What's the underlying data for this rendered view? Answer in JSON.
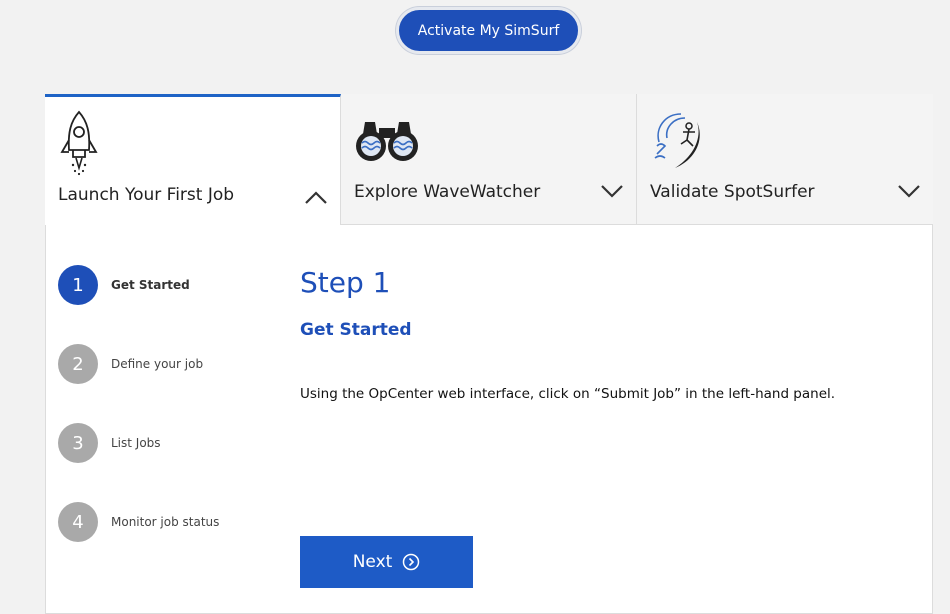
{
  "activate_button": {
    "label": "Activate My SimSurf"
  },
  "tabs": [
    {
      "label": "Launch Your First Job",
      "icon": "rocket-icon",
      "expanded": true
    },
    {
      "label": "Explore WaveWatcher",
      "icon": "binoculars-icon",
      "expanded": false
    },
    {
      "label": "Validate SpotSurfer",
      "icon": "surfer-icon",
      "expanded": false
    }
  ],
  "steps": [
    {
      "number": "1",
      "label": "Get Started",
      "active": true
    },
    {
      "number": "2",
      "label": "Define your job",
      "active": false
    },
    {
      "number": "3",
      "label": "List Jobs",
      "active": false
    },
    {
      "number": "4",
      "label": "Monitor job status",
      "active": false
    }
  ],
  "content": {
    "title": "Step 1",
    "subtitle": "Get Started",
    "body": "Using the OpCenter web interface, click on “Submit Job” in the left-hand panel."
  },
  "next_button": {
    "label": "Next",
    "icon": "arrow-circle-right-icon"
  },
  "colors": {
    "primary": "#1e4fb8",
    "tab_accent": "#1e63c6",
    "inactive_step": "#a9a9a9"
  }
}
